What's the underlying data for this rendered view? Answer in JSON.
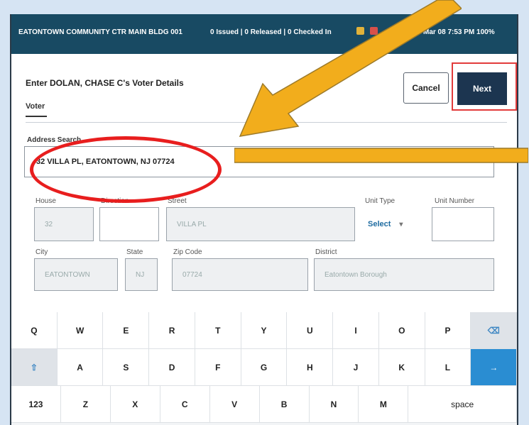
{
  "topbar": {
    "location": "EATONTOWN COMMUNITY CTR MAIN BLDG 001",
    "status": "0 Issued | 0 Released | 0 Checked In",
    "time": "Mar 08 7:53 PM 100%"
  },
  "header": {
    "title": "Enter DOLAN, CHASE C's Voter Details",
    "cancel_label": "Cancel",
    "next_label": "Next"
  },
  "tabs": {
    "voter": "Voter"
  },
  "address_search": {
    "label": "Address Search",
    "value": "32 VILLA PL, EATONTOWN, NJ 07724"
  },
  "fields": {
    "house": {
      "label": "House",
      "value": "32"
    },
    "direction": {
      "label": "Direction",
      "value": ""
    },
    "street": {
      "label": "Street",
      "value": "VILLA PL"
    },
    "unit_type": {
      "label": "Unit Type",
      "value": "Select"
    },
    "unit_number": {
      "label": "Unit Number",
      "value": ""
    },
    "city": {
      "label": "City",
      "value": "EATONTOWN"
    },
    "state": {
      "label": "State",
      "value": "NJ"
    },
    "zip": {
      "label": "Zip Code",
      "value": "07724"
    },
    "district": {
      "label": "District",
      "value": "Eatontown Borough"
    }
  },
  "keyboard": {
    "row1": [
      "Q",
      "W",
      "E",
      "R",
      "T",
      "Y",
      "U",
      "I",
      "O",
      "P",
      "⌫"
    ],
    "row2": [
      "⇧",
      "A",
      "S",
      "D",
      "F",
      "G",
      "H",
      "J",
      "K",
      "L",
      "→"
    ],
    "row3": [
      "123",
      "Z",
      "X",
      "C",
      "V",
      "B",
      "N",
      "M",
      "space"
    ]
  },
  "colors": {
    "topbar": "#184a63",
    "next_button": "#1c3550",
    "highlight_red": "#e23b3b",
    "arrow_gold": "#f2ad1c",
    "enter_key": "#2a8dd2"
  }
}
